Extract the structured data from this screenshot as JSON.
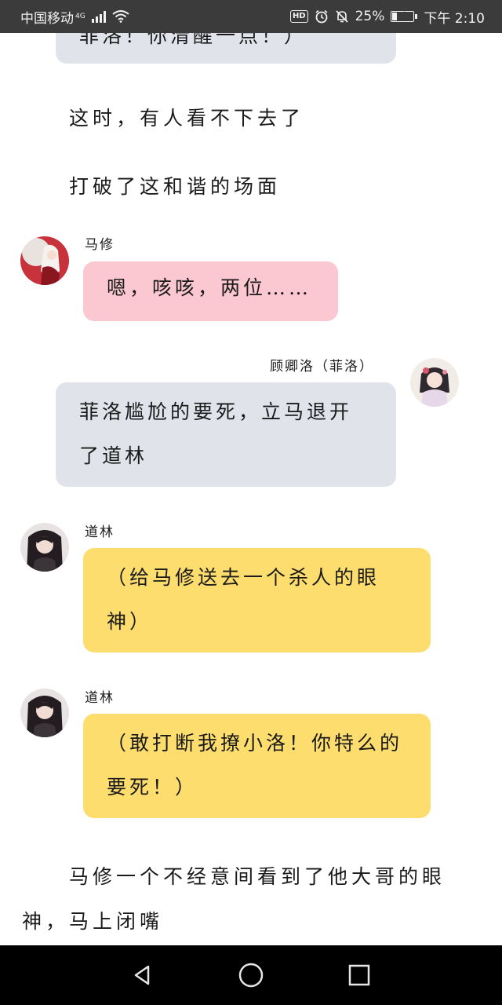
{
  "status_bar": {
    "carrier": "中国移动",
    "network": "4G",
    "hd_label": "HD",
    "battery_percent": "25%",
    "battery_level": 0.25,
    "time": "下午 2:10",
    "icons": [
      "signal-icon",
      "wifi-icon",
      "hd-icon",
      "alarm-icon",
      "mute-icon",
      "battery-icon"
    ]
  },
  "story": {
    "partial_bubble_text": "菲洛！你清醒一点！）",
    "narration_1": "这时，有人看不下去了",
    "narration_2": "打破了这和谐的场面",
    "messages": [
      {
        "speaker": "马修",
        "side": "left",
        "color": "#fbc8d2",
        "text": "嗯，咳咳，两位……"
      },
      {
        "speaker": "顾卿洛（菲洛）",
        "side": "right",
        "color": "#e0e4ea",
        "text": "菲洛尴尬的要死，立马退开了道林"
      },
      {
        "speaker": "道林",
        "side": "left",
        "color": "#fddd6e",
        "text": "（给马修送去一个杀人的眼神）"
      },
      {
        "speaker": "道林",
        "side": "left",
        "color": "#fddd6e",
        "text": "（敢打断我撩小洛！你特么的要死！）"
      }
    ],
    "narration_3": "马修一个不经意间看到了他大哥的眼神，马上闭嘴"
  },
  "nav_bar": {
    "buttons": [
      "back-icon",
      "home-icon",
      "recents-icon"
    ]
  }
}
